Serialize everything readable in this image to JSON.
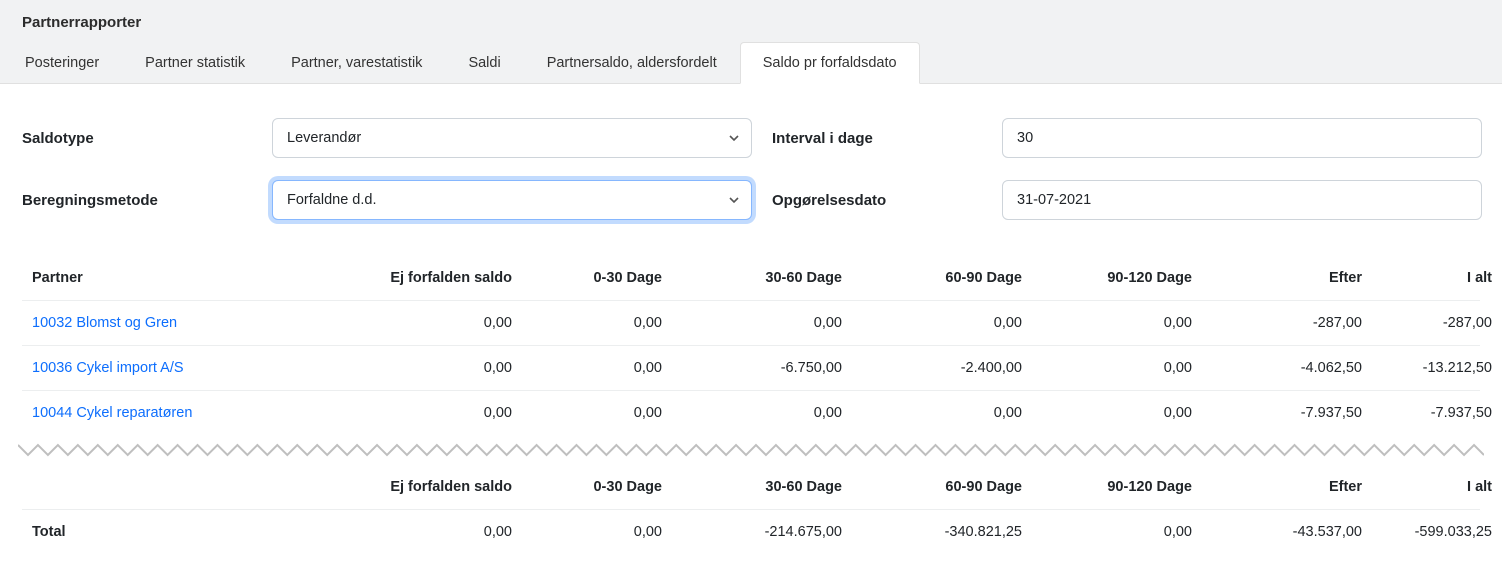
{
  "header": {
    "title": "Partnerrapporter"
  },
  "tabs": [
    {
      "label": "Posteringer",
      "active": false
    },
    {
      "label": "Partner statistik",
      "active": false
    },
    {
      "label": "Partner, varestatistik",
      "active": false
    },
    {
      "label": "Saldi",
      "active": false
    },
    {
      "label": "Partnersaldo, aldersfordelt",
      "active": false
    },
    {
      "label": "Saldo pr forfaldsdato",
      "active": true
    }
  ],
  "form": {
    "saldotype_label": "Saldotype",
    "saldotype_value": "Leverandør",
    "interval_label": "Interval i dage",
    "interval_value": "30",
    "beregning_label": "Beregningsmetode",
    "beregning_value": "Forfaldne d.d.",
    "opgorelse_label": "Opgørelsesdato",
    "opgorelse_value": "31-07-2021"
  },
  "table": {
    "columns": {
      "partner": "Partner",
      "not_due": "Ej forfalden saldo",
      "c0_30": "0-30 Dage",
      "c30_60": "30-60 Dage",
      "c60_90": "60-90 Dage",
      "c90_120": "90-120 Dage",
      "after": "Efter",
      "total": "I alt"
    },
    "rows": [
      {
        "partner": "10032 Blomst og Gren",
        "not_due": "0,00",
        "c0_30": "0,00",
        "c30_60": "0,00",
        "c60_90": "0,00",
        "c90_120": "0,00",
        "after": "-287,00",
        "total": "-287,00"
      },
      {
        "partner": "10036 Cykel import A/S",
        "not_due": "0,00",
        "c0_30": "0,00",
        "c30_60": "-6.750,00",
        "c60_90": "-2.400,00",
        "c90_120": "0,00",
        "after": "-4.062,50",
        "total": "-13.212,50"
      },
      {
        "partner": "10044 Cykel reparatøren",
        "not_due": "0,00",
        "c0_30": "0,00",
        "c30_60": "0,00",
        "c60_90": "0,00",
        "c90_120": "0,00",
        "after": "-7.937,50",
        "total": "-7.937,50"
      }
    ],
    "footer_label": "Total",
    "footer": {
      "not_due": "0,00",
      "c0_30": "0,00",
      "c30_60": "-214.675,00",
      "c60_90": "-340.821,25",
      "c90_120": "0,00",
      "after": "-43.537,00",
      "total": "-599.033,25"
    }
  }
}
